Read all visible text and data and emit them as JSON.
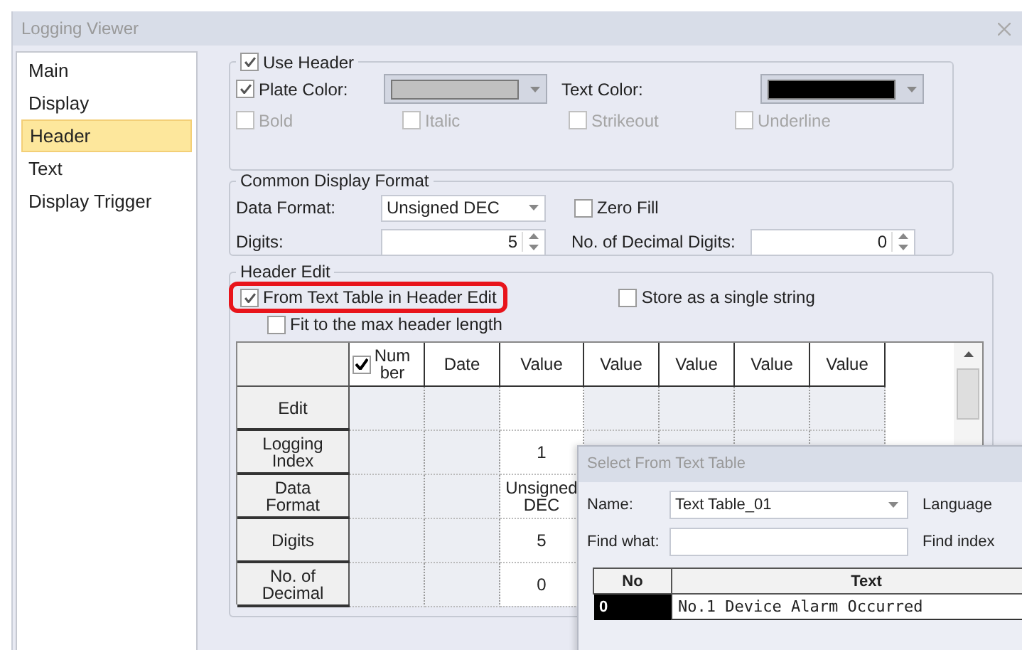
{
  "window": {
    "title": "Logging Viewer"
  },
  "sidebar": {
    "items": [
      {
        "label": "Main",
        "selected": false
      },
      {
        "label": "Display",
        "selected": false
      },
      {
        "label": "Header",
        "selected": true
      },
      {
        "label": "Text",
        "selected": false
      },
      {
        "label": "Display Trigger",
        "selected": false
      }
    ]
  },
  "header_group": {
    "use_header": {
      "label": "Use Header",
      "checked": true
    },
    "plate_color": {
      "label": "Plate Color:",
      "checked": true,
      "color": "#c0c0c0"
    },
    "text_color": {
      "label": "Text Color:",
      "color": "#000000"
    },
    "styles": [
      {
        "label": "Bold",
        "checked": false,
        "disabled": true
      },
      {
        "label": "Italic",
        "checked": false,
        "disabled": true
      },
      {
        "label": "Strikeout",
        "checked": false,
        "disabled": true
      },
      {
        "label": "Underline",
        "checked": false,
        "disabled": true
      }
    ]
  },
  "common_format": {
    "title": "Common Display Format",
    "data_format": {
      "label": "Data Format:",
      "value": "Unsigned DEC"
    },
    "zero_fill": {
      "label": "Zero Fill",
      "checked": false
    },
    "digits": {
      "label": "Digits:",
      "value": "5"
    },
    "decimal_digits": {
      "label": "No. of Decimal Digits:",
      "value": "0"
    }
  },
  "header_edit": {
    "title": "Header Edit",
    "from_text_table": {
      "label": "From Text Table in Header Edit",
      "checked": true,
      "highlighted": true
    },
    "store_single": {
      "label": "Store as a single string",
      "checked": false
    },
    "fit_max": {
      "label": "Fit to the max header length",
      "checked": false
    },
    "columns": [
      {
        "kind": "checkbox",
        "label": "Number",
        "checked": true
      },
      {
        "kind": "text",
        "label": "Date"
      },
      {
        "kind": "text",
        "label": "Value"
      },
      {
        "kind": "text",
        "label": "Value"
      },
      {
        "kind": "text",
        "label": "Value"
      },
      {
        "kind": "text",
        "label": "Value"
      },
      {
        "kind": "text",
        "label": "Value"
      }
    ],
    "rows": [
      {
        "label": "Edit"
      },
      {
        "label": "Logging Index",
        "value": "1"
      },
      {
        "label": "Data Format",
        "value": "Unsigned DEC"
      },
      {
        "label": "Digits",
        "value": "5"
      },
      {
        "label": "No. of Decimal",
        "value": "0"
      }
    ]
  },
  "text_table_dialog": {
    "title": "Select From Text Table",
    "name": {
      "label": "Name:",
      "value": "Text Table_01"
    },
    "language_label": "Language",
    "find_what": {
      "label": "Find what:"
    },
    "find_index_label": "Find index",
    "columns": [
      "No",
      "Text"
    ],
    "rows": [
      {
        "no": "0",
        "text": "No.1 Device Alarm Occurred",
        "selected": true
      }
    ]
  }
}
